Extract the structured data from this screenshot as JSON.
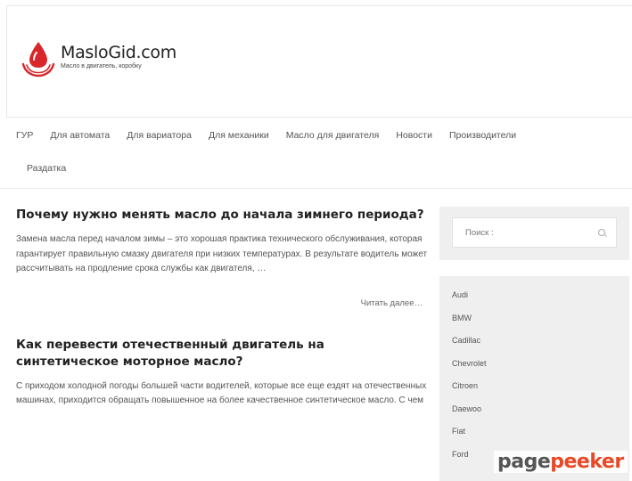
{
  "site": {
    "name": "MasloGid.com",
    "tagline": "Масло в двигатель, коробку"
  },
  "nav": {
    "row1": [
      "ГУР",
      "Для автомата",
      "Для вариатора",
      "Для механики",
      "Масло для двигателя",
      "Новости",
      "Производители"
    ],
    "row2": [
      "Раздатка"
    ]
  },
  "posts": [
    {
      "title": "Почему нужно менять масло до начала зимнего периода?",
      "excerpt": "Замена масла перед началом зимы – это хорошая практика технического обслуживания, которая гарантирует правильную смазку двигателя при низких температурах. В результате водитель может рассчитывать на продление срока службы как двигателя, …",
      "read_more": "Читать далее…"
    },
    {
      "title": "Как перевести отечественный двигатель на синтетическое моторное масло?",
      "excerpt": "С приходом холодной погоды большей части водителей, которые все еще ездят на отечественных машинах, приходится обращать повышенное на более качественное синтетическое масло. С чем",
      "read_more": ""
    }
  ],
  "sidebar": {
    "search_placeholder": "Поиск :",
    "brands": [
      "Audi",
      "BMW",
      "Cadillac",
      "Chevrolet",
      "Citroen",
      "Daewoo",
      "Fiat",
      "Ford"
    ]
  },
  "watermark": {
    "part1": "page",
    "part2": "peeker"
  },
  "colors": {
    "logo_red": "#d8262b",
    "watermark_orange": "#e84a27",
    "sidebar_bg": "#efefef"
  },
  "icons": {
    "logo": "oil-drop-icon",
    "search": "search-icon"
  }
}
